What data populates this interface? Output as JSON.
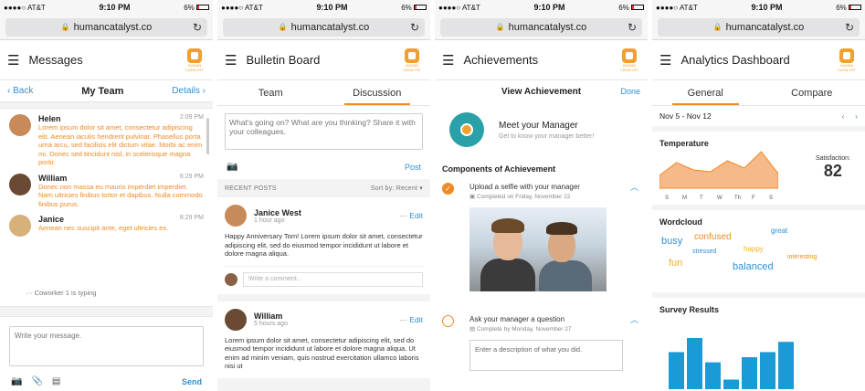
{
  "status": {
    "carrier": "●●●●○ AT&T",
    "time": "9:10 PM",
    "battery": "6%"
  },
  "url": "humancatalyst.co",
  "logo_text": "HUMAN CATALYST",
  "messages": {
    "title": "Messages",
    "back": "Back",
    "team": "My Team",
    "details": "Details",
    "items": [
      {
        "name": "Helen",
        "time": "2:09 PM",
        "text": "Lorem ipsum dolor sit amet, consectetur adipiscing elit. Aenean iaculis hendrerit pulvinar. Phasellus porta urna arcu, sed facilisis elit dictum vitae. Morbi ac enim mi. Donec sed tincidunt nisl, in scelerisque magna portir."
      },
      {
        "name": "William",
        "time": "6:29 PM",
        "text": "Donec non massa eu mauris imperdiet imperdiet. Nam ultricies finibus tortor et dapibus. Nulla commodo finibus purus."
      },
      {
        "name": "Janice",
        "time": "8:29 PM",
        "text": "Aenean nec suscipit ante, eget ultricies ex."
      }
    ],
    "typing": "Coworker 1 is typing",
    "compose_placeholder": "Write your message.",
    "send": "Send"
  },
  "bulletin": {
    "title": "Bulletin Board",
    "tabs": [
      "Team",
      "Discussion"
    ],
    "post_placeholder": "What's going on? What are you thinking? Share it with your colleagues.",
    "post_button": "Post",
    "recent_label": "RECENT POSTS",
    "sort_label": "Sort by: Recent ▾",
    "posts": [
      {
        "name": "Janice West",
        "time": "1 hour ago",
        "text": "Happy Anniversary Tom! Lorem ipsum dolor sit amet, consectetur adipiscing elit, sed do eiusmod tempor incididunt ut labore et dolore magna aliqua.",
        "comment_placeholder": "Write a comment...",
        "edit": "Edit",
        "more": "···"
      },
      {
        "name": "William",
        "time": "5 hours ago",
        "text": "Lorem ipsum dolor sit amet, consectetur adipiscing elit, sed do eiusmod tempor incididunt ut labore et dolore magna aliqua. Ut enim ad minim veniam, quis nostrud exercitation ullamco laboris nisi ut",
        "edit": "Edit",
        "more": "···"
      }
    ]
  },
  "achievements": {
    "title": "Achievements",
    "view_title": "View Achievement",
    "done": "Done",
    "name": "Meet your Manager",
    "subtitle": "Get to know your manager better!",
    "components_title": "Components of Achievement",
    "tasks": [
      {
        "title": "Upload a selfie with your manager",
        "sub": "Completed on Friday, November 22",
        "done": true
      },
      {
        "title": "Ask your manager a question",
        "sub": "Complete by Monday, November 27",
        "done": false,
        "input_placeholder": "Enter a description of what you did."
      }
    ]
  },
  "analytics": {
    "title": "Analytics Dashboard",
    "tabs": [
      "General",
      "Compare"
    ],
    "date_range": "Nov 5 - Nov 12",
    "temperature_title": "Temperature",
    "satisfaction_label": "Satisfaction:",
    "satisfaction_value": "82",
    "days": [
      "S",
      "M",
      "T",
      "W",
      "Th",
      "F",
      "S"
    ],
    "temperature_values": [
      0.35,
      0.7,
      0.5,
      0.45,
      0.75,
      0.55,
      1.0,
      0.4
    ],
    "wordcloud_title": "Wordcloud",
    "words": [
      {
        "text": "busy",
        "color": "#2f8fd6"
      },
      {
        "text": "confused",
        "color": "#f08a24"
      },
      {
        "text": "great",
        "color": "#2f8fd6"
      },
      {
        "text": "happy",
        "color": "#f0b030"
      },
      {
        "text": "stressed",
        "color": "#2f8fd6"
      },
      {
        "text": "fun",
        "color": "#f0b030"
      },
      {
        "text": "balanced",
        "color": "#2f8fd6"
      },
      {
        "text": "interesting",
        "color": "#f08a24"
      }
    ],
    "survey_title": "Survey Results",
    "survey_values": [
      0.58,
      0.8,
      0.42,
      0.15,
      0.5,
      0.58,
      0.74
    ],
    "colors": {
      "accent": "#f08a24",
      "blue": "#2f8fd6",
      "bar": "#1a9ad6",
      "area": "#f6b98a"
    }
  }
}
